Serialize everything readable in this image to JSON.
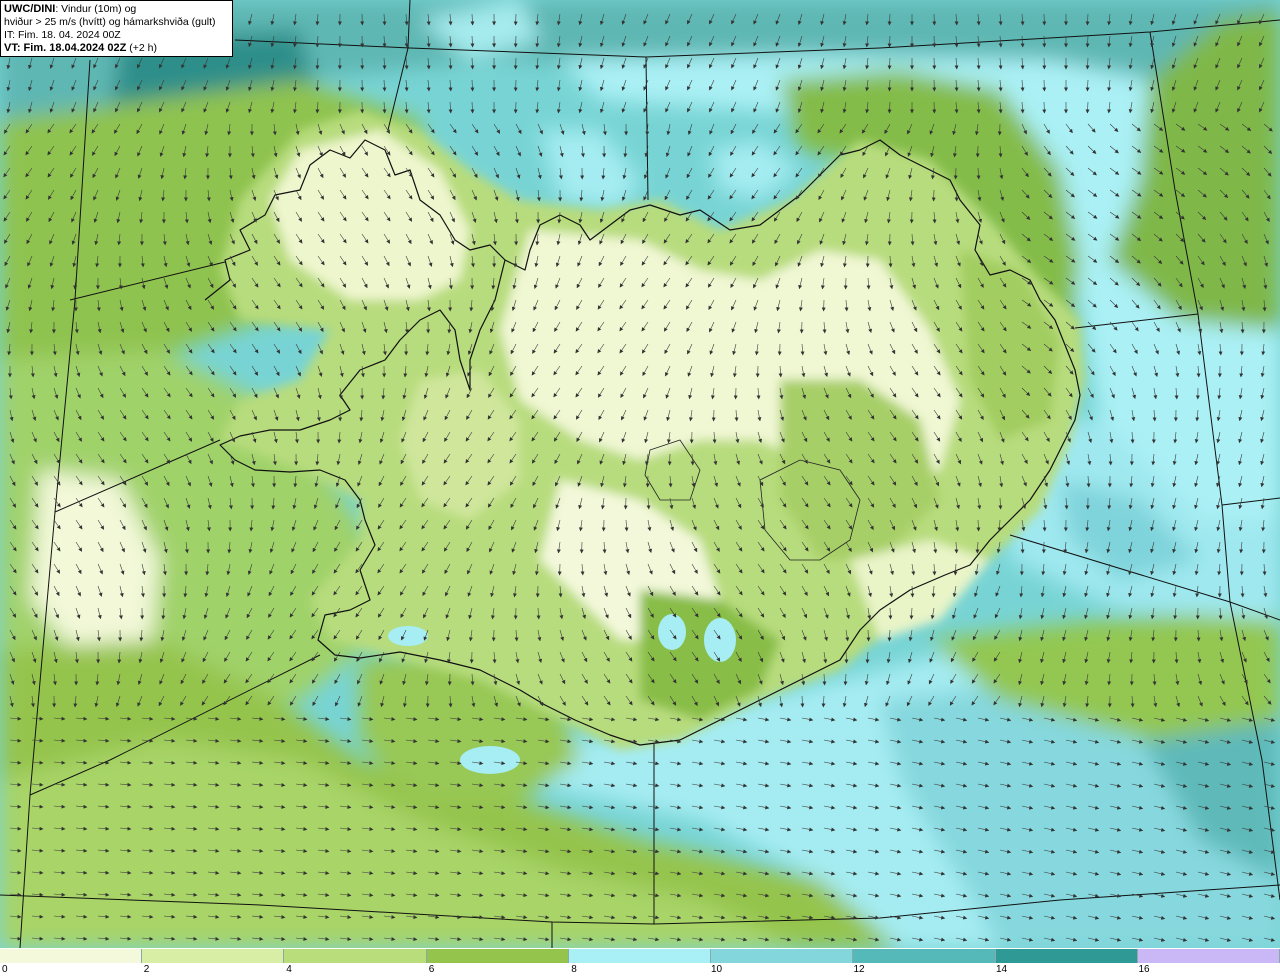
{
  "title": {
    "model": "UWC/DINI",
    "line1_rest": ": Vindur (10m) og",
    "line2": "hviður > 25 m/s (hvítt) og hámarkshviða (gult)",
    "line3": "IT: Fim. 18. 04. 2024 00Z",
    "line4_bold": "VT: Fim. 18.04.2024 02Z",
    "line4_rest": " (+2 h)"
  },
  "scale": {
    "colors": [
      "#f4f9dc",
      "#d8eea4",
      "#b9dd7a",
      "#95c44d",
      "#a9f0f6",
      "#82d6dc",
      "#56b9b9",
      "#2f9a95",
      "#c9b7f6"
    ],
    "ticks": [
      "0",
      "2",
      "4",
      "6",
      "8",
      "10",
      "12",
      "14",
      "16"
    ]
  },
  "legend_units": "m/s",
  "icons": {
    "wind_arrow": "wind-arrow-icon"
  }
}
